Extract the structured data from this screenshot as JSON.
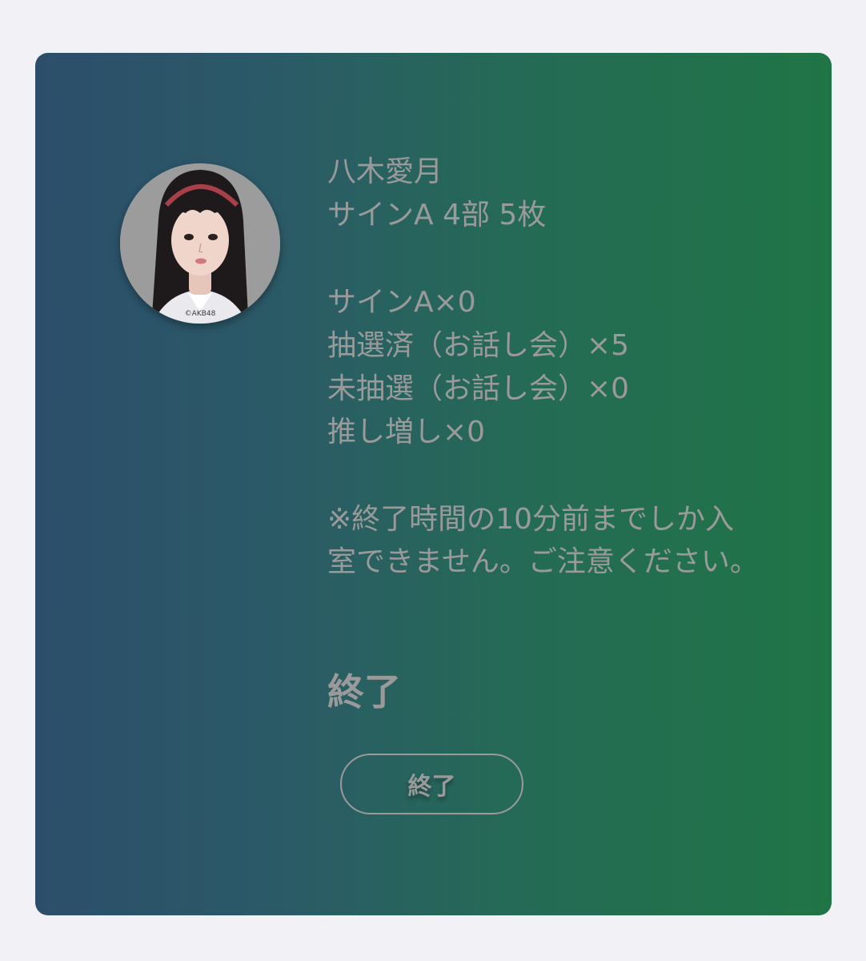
{
  "member": {
    "name": "八木愛月",
    "photo_credit": "©AKB48"
  },
  "ticket": {
    "summary": "サインA 4部 5枚"
  },
  "counts": [
    "サインA×0",
    "抽選済（お話し会）×5",
    "未抽選（お話し会）×0",
    "推し増し×0"
  ],
  "notice": "※終了時間の10分前までしか入室できません。ご注意ください。",
  "status_label": "終了",
  "end_button_label": "終了",
  "colors": {
    "page_background": "#f1f1f6",
    "card_gradient_start": "#2c4e6b",
    "card_gradient_end": "#1f7546",
    "text": "#9a9a9a"
  }
}
